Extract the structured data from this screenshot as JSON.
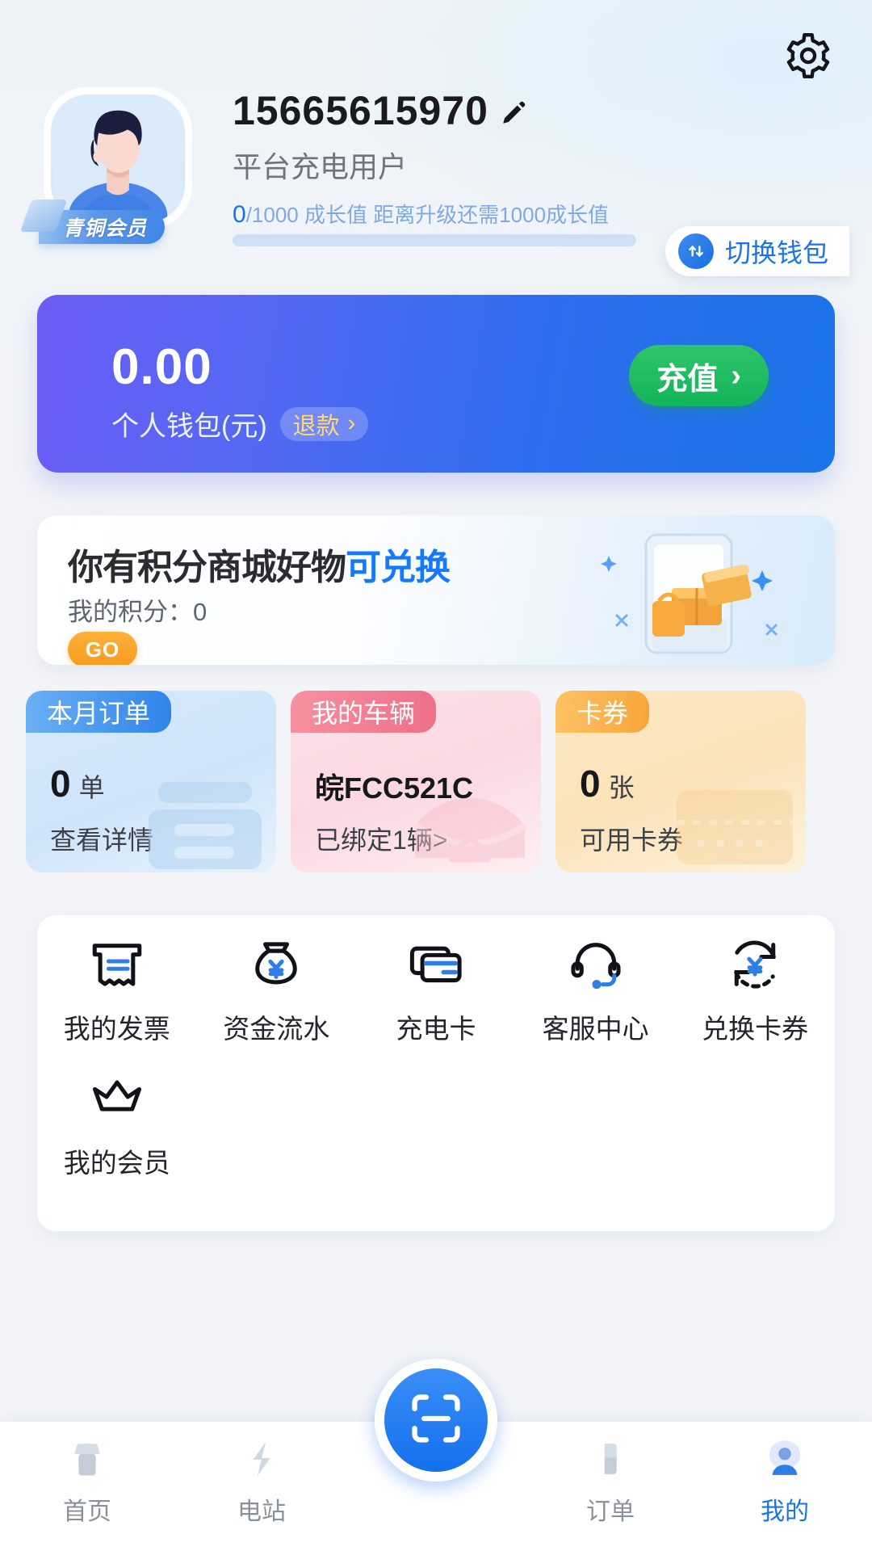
{
  "header": {
    "gear_icon": "gear-icon",
    "phone": "15665615970",
    "edit_icon": "pencil-icon",
    "user_type": "平台充电用户",
    "growth_current": "0",
    "growth_suffix": "/1000 成长值 距离升级还需1000成长值",
    "growth_percent": 0,
    "member_badge": "青铜会员",
    "switch_wallet_label": "切换钱包",
    "switch_wallet_icon": "wallet-switch-icon"
  },
  "wallet": {
    "amount": "0.00",
    "label": "个人钱包(元)",
    "refund_label": "退款",
    "refund_arrow": "›",
    "topup_label": "充值",
    "topup_arrow": "›",
    "gradient_from": "#6b5cf6",
    "gradient_to": "#1a73e8"
  },
  "points_banner": {
    "title_plain": "你有积分商城好物",
    "title_accent": "可兑换",
    "accent_color": "#1677ff",
    "my_points_label": "我的积分：",
    "my_points_value": "0",
    "go_label": "GO",
    "go_color": "#f79a1e",
    "art_icon": "gift-package-illustration"
  },
  "stat_cards": [
    {
      "tab": "本月订单",
      "value": "0",
      "unit": "单",
      "foot": "查看详情",
      "accent": "#2f84ea",
      "deco_icon": "order-list-icon"
    },
    {
      "tab": "我的车辆",
      "plate": "皖FCC521C",
      "foot": "已绑定1辆>",
      "accent": "#ef6f88",
      "deco_icon": "car-icon"
    },
    {
      "tab": "卡券",
      "value": "0",
      "unit": "张",
      "foot": "可用卡券",
      "accent": "#f6a53a",
      "deco_icon": "coupon-icon"
    }
  ],
  "menu": {
    "row1": [
      {
        "label": "我的发票",
        "icon": "invoice-icon"
      },
      {
        "label": "资金流水",
        "icon": "money-bag-icon"
      },
      {
        "label": "充电卡",
        "icon": "charge-card-icon"
      },
      {
        "label": "客服中心",
        "icon": "headset-icon"
      },
      {
        "label": "兑换卡券",
        "icon": "exchange-coupon-icon"
      }
    ],
    "row2": [
      {
        "label": "我的会员",
        "icon": "crown-icon"
      }
    ]
  },
  "tabbar": {
    "items": [
      {
        "label": "首页",
        "icon": "home-icon",
        "active": false
      },
      {
        "label": "电站",
        "icon": "charging-station-icon",
        "active": false
      },
      {
        "label": "订单",
        "icon": "orders-icon",
        "active": false
      },
      {
        "label": "我的",
        "icon": "profile-icon",
        "active": true
      }
    ],
    "scan_icon": "scan-icon",
    "active_color": "#1a73e8"
  }
}
